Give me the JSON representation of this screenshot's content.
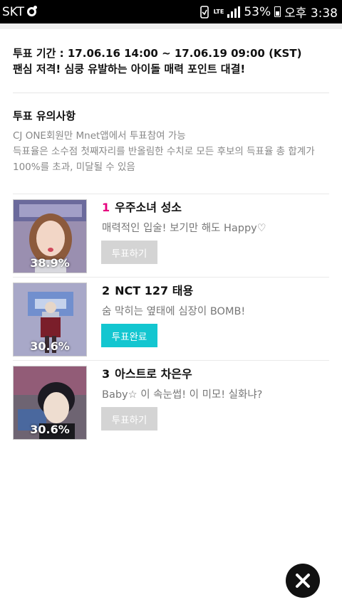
{
  "status_bar": {
    "carrier": "SKT",
    "network": "LTE",
    "battery": "53%",
    "time": "오후 3:38"
  },
  "vote_info": {
    "period": "투표 기간 : 17.06.16 14:00 ~ 17.06.19 09:00 (KST)",
    "headline": "팬심 저격! 심쿵 유발하는 아이돌 매력 포인트 대결!"
  },
  "notice": {
    "title": "투표 유의사항",
    "line1": "CJ ONE회원만 Mnet앱에서 투표참여 가능",
    "line2": "득표율은 소수점 첫째자리를 반올림한 수치로 모든 후보의 득표율 총 합계가 100%를 초과, 미달될 수 있음"
  },
  "candidates": [
    {
      "rank": "1",
      "name": "우주소녀 성소",
      "description": "매력적인 입술! 보기만 해도 Happy♡",
      "percent": "38.9%",
      "vote_label": "투표하기",
      "voted": false
    },
    {
      "rank": "2",
      "name": "NCT 127 태용",
      "description": "숨 막히는 옆태에 심장이 BOMB!",
      "percent": "30.6%",
      "vote_label": "투표완료",
      "voted": true
    },
    {
      "rank": "3",
      "name": "아스트로 차은우",
      "description": "Baby☆ 이 속눈썹! 이 미모! 실화냐?",
      "percent": "30.6%",
      "vote_label": "투표하기",
      "voted": false
    }
  ],
  "icons": {
    "close": "close-icon"
  },
  "colors": {
    "rank_first": "#e6007e",
    "vote_done": "#13c6d0",
    "vote_disabled": "#d4d4d4"
  }
}
